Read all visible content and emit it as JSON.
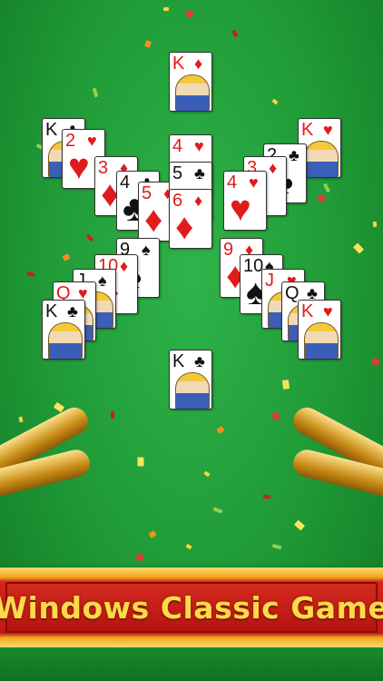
{
  "banner": {
    "title": "Windows Classic Game"
  },
  "colors": {
    "felt": "#1f9a36",
    "banner_red": "#c01716",
    "banner_text": "#ffd94a"
  },
  "center_column": [
    {
      "rank": "K",
      "suit": "♦",
      "color": "red"
    },
    {
      "rank": "4",
      "suit": "♥",
      "color": "red"
    },
    {
      "rank": "5",
      "suit": "♣",
      "color": "black"
    },
    {
      "rank": "6",
      "suit": "♦",
      "color": "red"
    },
    {
      "rank": "K",
      "suit": "♣",
      "color": "black"
    }
  ],
  "top_left_arm": [
    {
      "rank": "K",
      "suit": "♣",
      "color": "black"
    },
    {
      "rank": "2",
      "suit": "♥",
      "color": "red"
    },
    {
      "rank": "3",
      "suit": "♦",
      "color": "red"
    },
    {
      "rank": "4",
      "suit": "♣",
      "color": "black"
    },
    {
      "rank": "5",
      "suit": "♦",
      "color": "red"
    }
  ],
  "top_right_arm": [
    {
      "rank": "K",
      "suit": "♥",
      "color": "red"
    },
    {
      "rank": "2",
      "suit": "♣",
      "color": "black"
    },
    {
      "rank": "3",
      "suit": "♦",
      "color": "red"
    },
    {
      "rank": "4",
      "suit": "♥",
      "color": "red"
    }
  ],
  "bottom_left_arm": [
    {
      "rank": "K",
      "suit": "♣",
      "color": "black"
    },
    {
      "rank": "Q",
      "suit": "♥",
      "color": "red"
    },
    {
      "rank": "J",
      "suit": "♠",
      "color": "black"
    },
    {
      "rank": "10",
      "suit": "♦",
      "color": "red"
    },
    {
      "rank": "9",
      "suit": "♠",
      "color": "black"
    }
  ],
  "bottom_right_arm": [
    {
      "rank": "K",
      "suit": "♥",
      "color": "red"
    },
    {
      "rank": "Q",
      "suit": "♣",
      "color": "black"
    },
    {
      "rank": "J",
      "suit": "♥",
      "color": "red"
    },
    {
      "rank": "10",
      "suit": "♠",
      "color": "black"
    },
    {
      "rank": "9",
      "suit": "♦",
      "color": "red"
    }
  ],
  "decor": {
    "left_horn": "trumpet-icon",
    "right_horn": "trumpet-icon"
  }
}
